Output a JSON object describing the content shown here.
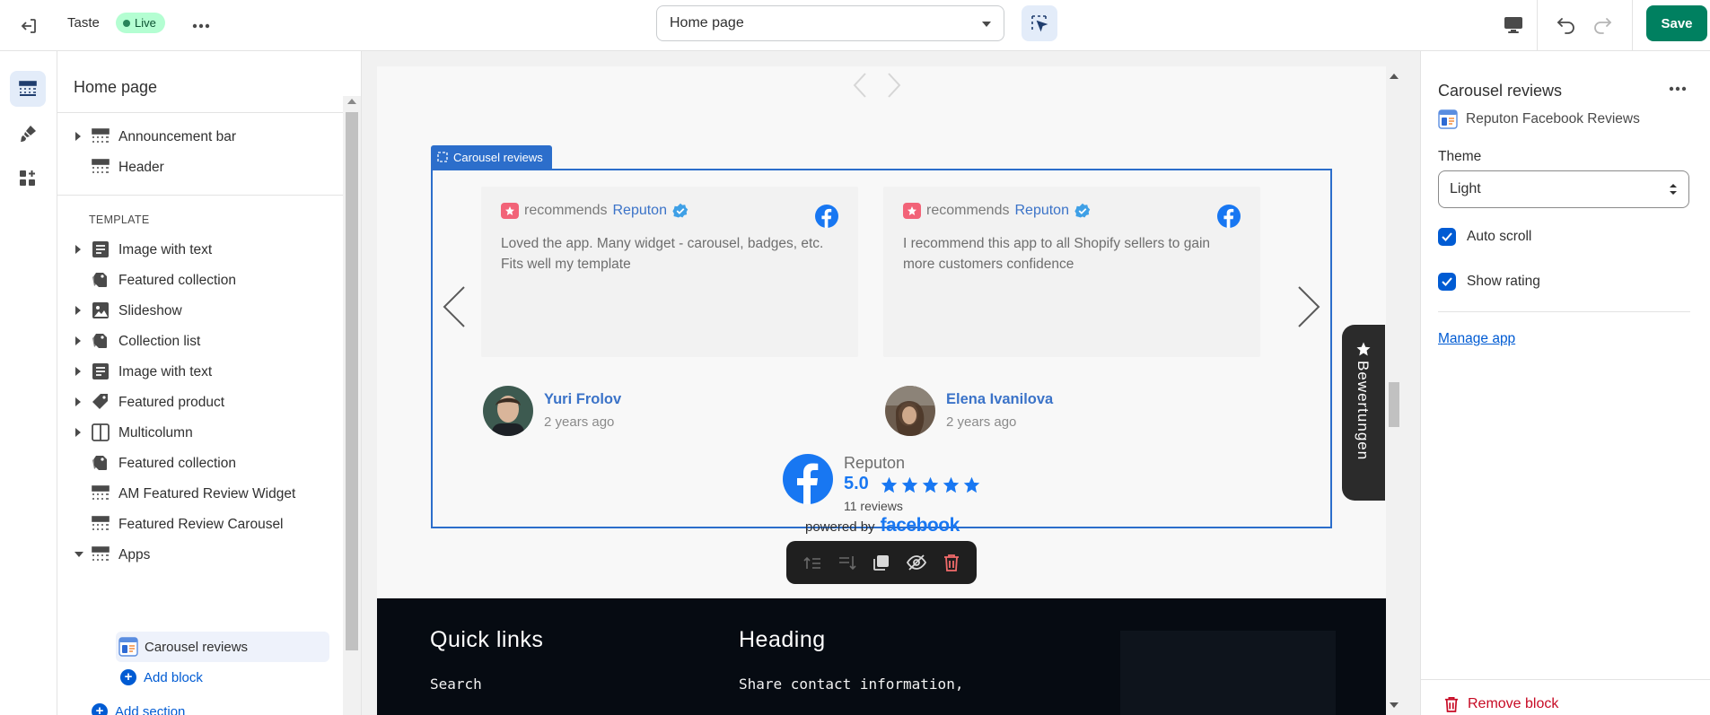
{
  "topbar": {
    "theme_name": "Taste",
    "status_badge": "Live",
    "page_selector": "Home page",
    "save_label": "Save"
  },
  "sidebar": {
    "title": "Home page",
    "header_items": [
      {
        "label": "Announcement bar",
        "icon": "section-bar-icon",
        "expandable": true
      },
      {
        "label": "Header",
        "icon": "section-bar-icon",
        "expandable": false
      }
    ],
    "template_label": "TEMPLATE",
    "template_items": [
      {
        "label": "Image with text",
        "icon": "text-block-icon",
        "expandable": true
      },
      {
        "label": "Featured collection",
        "icon": "collection-tag-icon",
        "expandable": false
      },
      {
        "label": "Slideshow",
        "icon": "image-icon",
        "expandable": true
      },
      {
        "label": "Collection list",
        "icon": "collection-tag-icon",
        "expandable": true
      },
      {
        "label": "Image with text",
        "icon": "text-block-icon",
        "expandable": true
      },
      {
        "label": "Featured product",
        "icon": "price-tag-icon",
        "expandable": true
      },
      {
        "label": "Multicolumn",
        "icon": "columns-icon",
        "expandable": true
      },
      {
        "label": "Featured collection",
        "icon": "collection-tag-icon",
        "expandable": false
      },
      {
        "label": "AM Featured Review Widget",
        "icon": "section-bar-icon",
        "expandable": false
      },
      {
        "label": "Featured Review Carousel",
        "icon": "section-bar-icon",
        "expandable": false
      },
      {
        "label": "Apps",
        "icon": "section-bar-icon",
        "expandable": true,
        "open": true
      }
    ],
    "selected_block": "Carousel reviews",
    "add_block": "Add block",
    "add_section": "Add section"
  },
  "canvas": {
    "block_tag": "Carousel reviews",
    "reviews": [
      {
        "recommends": "recommends",
        "brand": "Reputon",
        "text": "Loved the app. Many widget - carousel, badges, etc. Fits well my template",
        "reviewer": "Yuri Frolov",
        "ago": "2 years ago"
      },
      {
        "recommends": "recommends",
        "brand": "Reputon",
        "text": "I recommend this app to all Shopify sellers to gain more customers confidence",
        "reviewer": "Elena Ivanilova",
        "ago": "2 years ago"
      }
    ],
    "summary": {
      "brand": "Reputon",
      "rating": "5.0",
      "stars": 5,
      "count": "11 reviews"
    },
    "powered_by": "powered by",
    "powered_brand": "facebook",
    "side_tab": "Bewertungen",
    "footer": {
      "col1_heading": "Quick links",
      "col1_link": "Search",
      "col2_heading": "Heading",
      "col2_text": "Share contact information,"
    }
  },
  "panel": {
    "title": "Carousel reviews",
    "app_name": "Reputon Facebook Reviews",
    "theme_label": "Theme",
    "theme_value": "Light",
    "auto_scroll": "Auto scroll",
    "show_rating": "Show rating",
    "manage_app": "Manage app",
    "remove_block": "Remove block"
  },
  "colors": {
    "primary": "#005bd3",
    "save": "#008060",
    "selection": "#2c6ecb",
    "facebook": "#1877f2",
    "danger": "#c70a24"
  }
}
